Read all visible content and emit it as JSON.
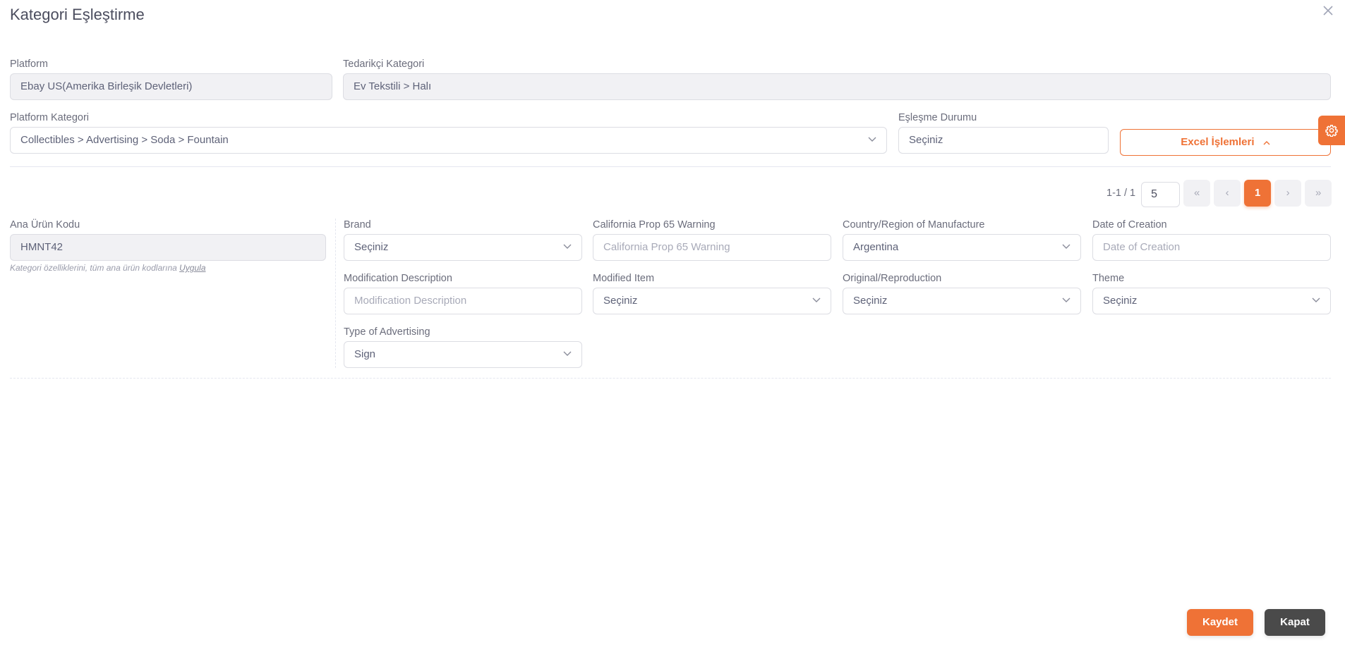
{
  "modal": {
    "title": "Kategori Eşleştirme",
    "close_icon": "close-icon"
  },
  "filters": {
    "platform": {
      "label": "Platform",
      "value": "Ebay US(Amerika Birleşik Devletleri)"
    },
    "supplier_category": {
      "label": "Tedarikçi Kategori",
      "value": "Ev Tekstili > Halı"
    },
    "platform_category": {
      "label": "Platform Kategori",
      "value": "Collectibles > Advertising > Soda > Fountain"
    },
    "match_status": {
      "label": "Eşleşme Durumu",
      "value": "Seçiniz"
    },
    "excel_button": {
      "label": "Excel İşlemleri",
      "caret": "^"
    }
  },
  "pagination": {
    "range_text": "1-1 / 1",
    "page_size": "5",
    "first": "«",
    "prev": "‹",
    "current": "1",
    "next": "›",
    "last": "»"
  },
  "product": {
    "main_code": {
      "label": "Ana Ürün Kodu",
      "value": "HMNT42"
    },
    "hint_text": "Kategori özelliklerini, tüm ana ürün kodlarına ",
    "hint_link": "Uygula"
  },
  "attributes": [
    {
      "label": "Brand",
      "value": "Seçiniz",
      "type": "select",
      "placeholder": false
    },
    {
      "label": "California Prop 65 Warning",
      "value": "California Prop 65 Warning",
      "type": "text",
      "placeholder": true
    },
    {
      "label": "Country/Region of Manufacture",
      "value": "Argentina",
      "type": "select",
      "placeholder": false
    },
    {
      "label": "Date of Creation",
      "value": "Date of Creation",
      "type": "text",
      "placeholder": true
    },
    {
      "label": "Modification Description",
      "value": "Modification Description",
      "type": "text",
      "placeholder": true
    },
    {
      "label": "Modified Item",
      "value": "Seçiniz",
      "type": "select",
      "placeholder": false
    },
    {
      "label": "Original/Reproduction",
      "value": "Seçiniz",
      "type": "select",
      "placeholder": false
    },
    {
      "label": "Theme",
      "value": "Seçiniz",
      "type": "select",
      "placeholder": false
    },
    {
      "label": "Type of Advertising",
      "value": "Sign",
      "type": "select",
      "placeholder": false
    }
  ],
  "footer": {
    "save_label": "Kaydet",
    "close_label": "Kapat"
  },
  "colors": {
    "accent": "#ef7236",
    "dark_button": "#4a4a4a",
    "disabled_bg": "#f1f1f4"
  }
}
